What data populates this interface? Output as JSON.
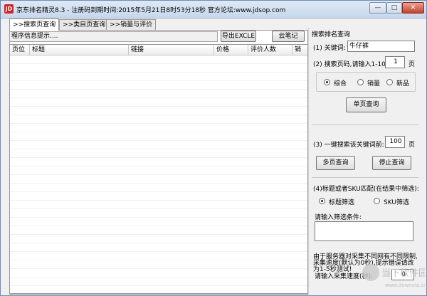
{
  "window": {
    "icon_text": "JD",
    "title": "京东排名精灵8.3 - 注册码到期时间:2015年5月21日8时53分18秒    官方论坛:www.jdsop.com",
    "minimize": "—",
    "maximize": "□",
    "close": "✕"
  },
  "tabs": [
    {
      "label": ">>搜索页查询"
    },
    {
      "label": ">>类目页查询"
    },
    {
      "label": ">>销量与评价"
    }
  ],
  "toolbar": {
    "status_text": "程序信息提示....",
    "export_button": "导出EXCLE",
    "notes_button": "云笔记"
  },
  "table": {
    "columns": [
      "页位",
      "标题",
      "链接",
      "价格",
      "评价人数",
      "销"
    ]
  },
  "search_panel": {
    "heading": "搜索排名查询",
    "keyword_label": "(1) 关键词:",
    "keyword_value": "牛仔裤",
    "page_label": "(2) 搜索页码,请输入1-100:",
    "page_value": "1",
    "page_unit": "页",
    "sort_options": [
      {
        "label": "综合",
        "selected": true
      },
      {
        "label": "销量",
        "selected": false
      },
      {
        "label": "新品",
        "selected": false
      }
    ],
    "single_query_button": "单页查询",
    "batch_label": "(3) 一键搜索该关键词前:",
    "batch_value": "100",
    "batch_unit": "页",
    "multi_query_button": "多页查询",
    "stop_query_button": "停止查询",
    "filter_label": "(4)标题或者SKU匹配(在结果中筛选):",
    "filter_options": [
      {
        "label": "标题筛选",
        "selected": true
      },
      {
        "label": "SKU筛选",
        "selected": false
      }
    ],
    "filter_prompt": "请输入筛选条件:",
    "filter_value": "",
    "notice_line1": "由于服务器对采集不同网有不同限制,",
    "notice_line2": "采集速度(默认为0秒),提示错误请改",
    "notice_line3": "为1-5秒测试!",
    "speed_label": "请输入采集速度(秒):",
    "speed_value": "0"
  },
  "watermark": {
    "text": "当下软件园",
    "url": "www.downxia.com"
  }
}
